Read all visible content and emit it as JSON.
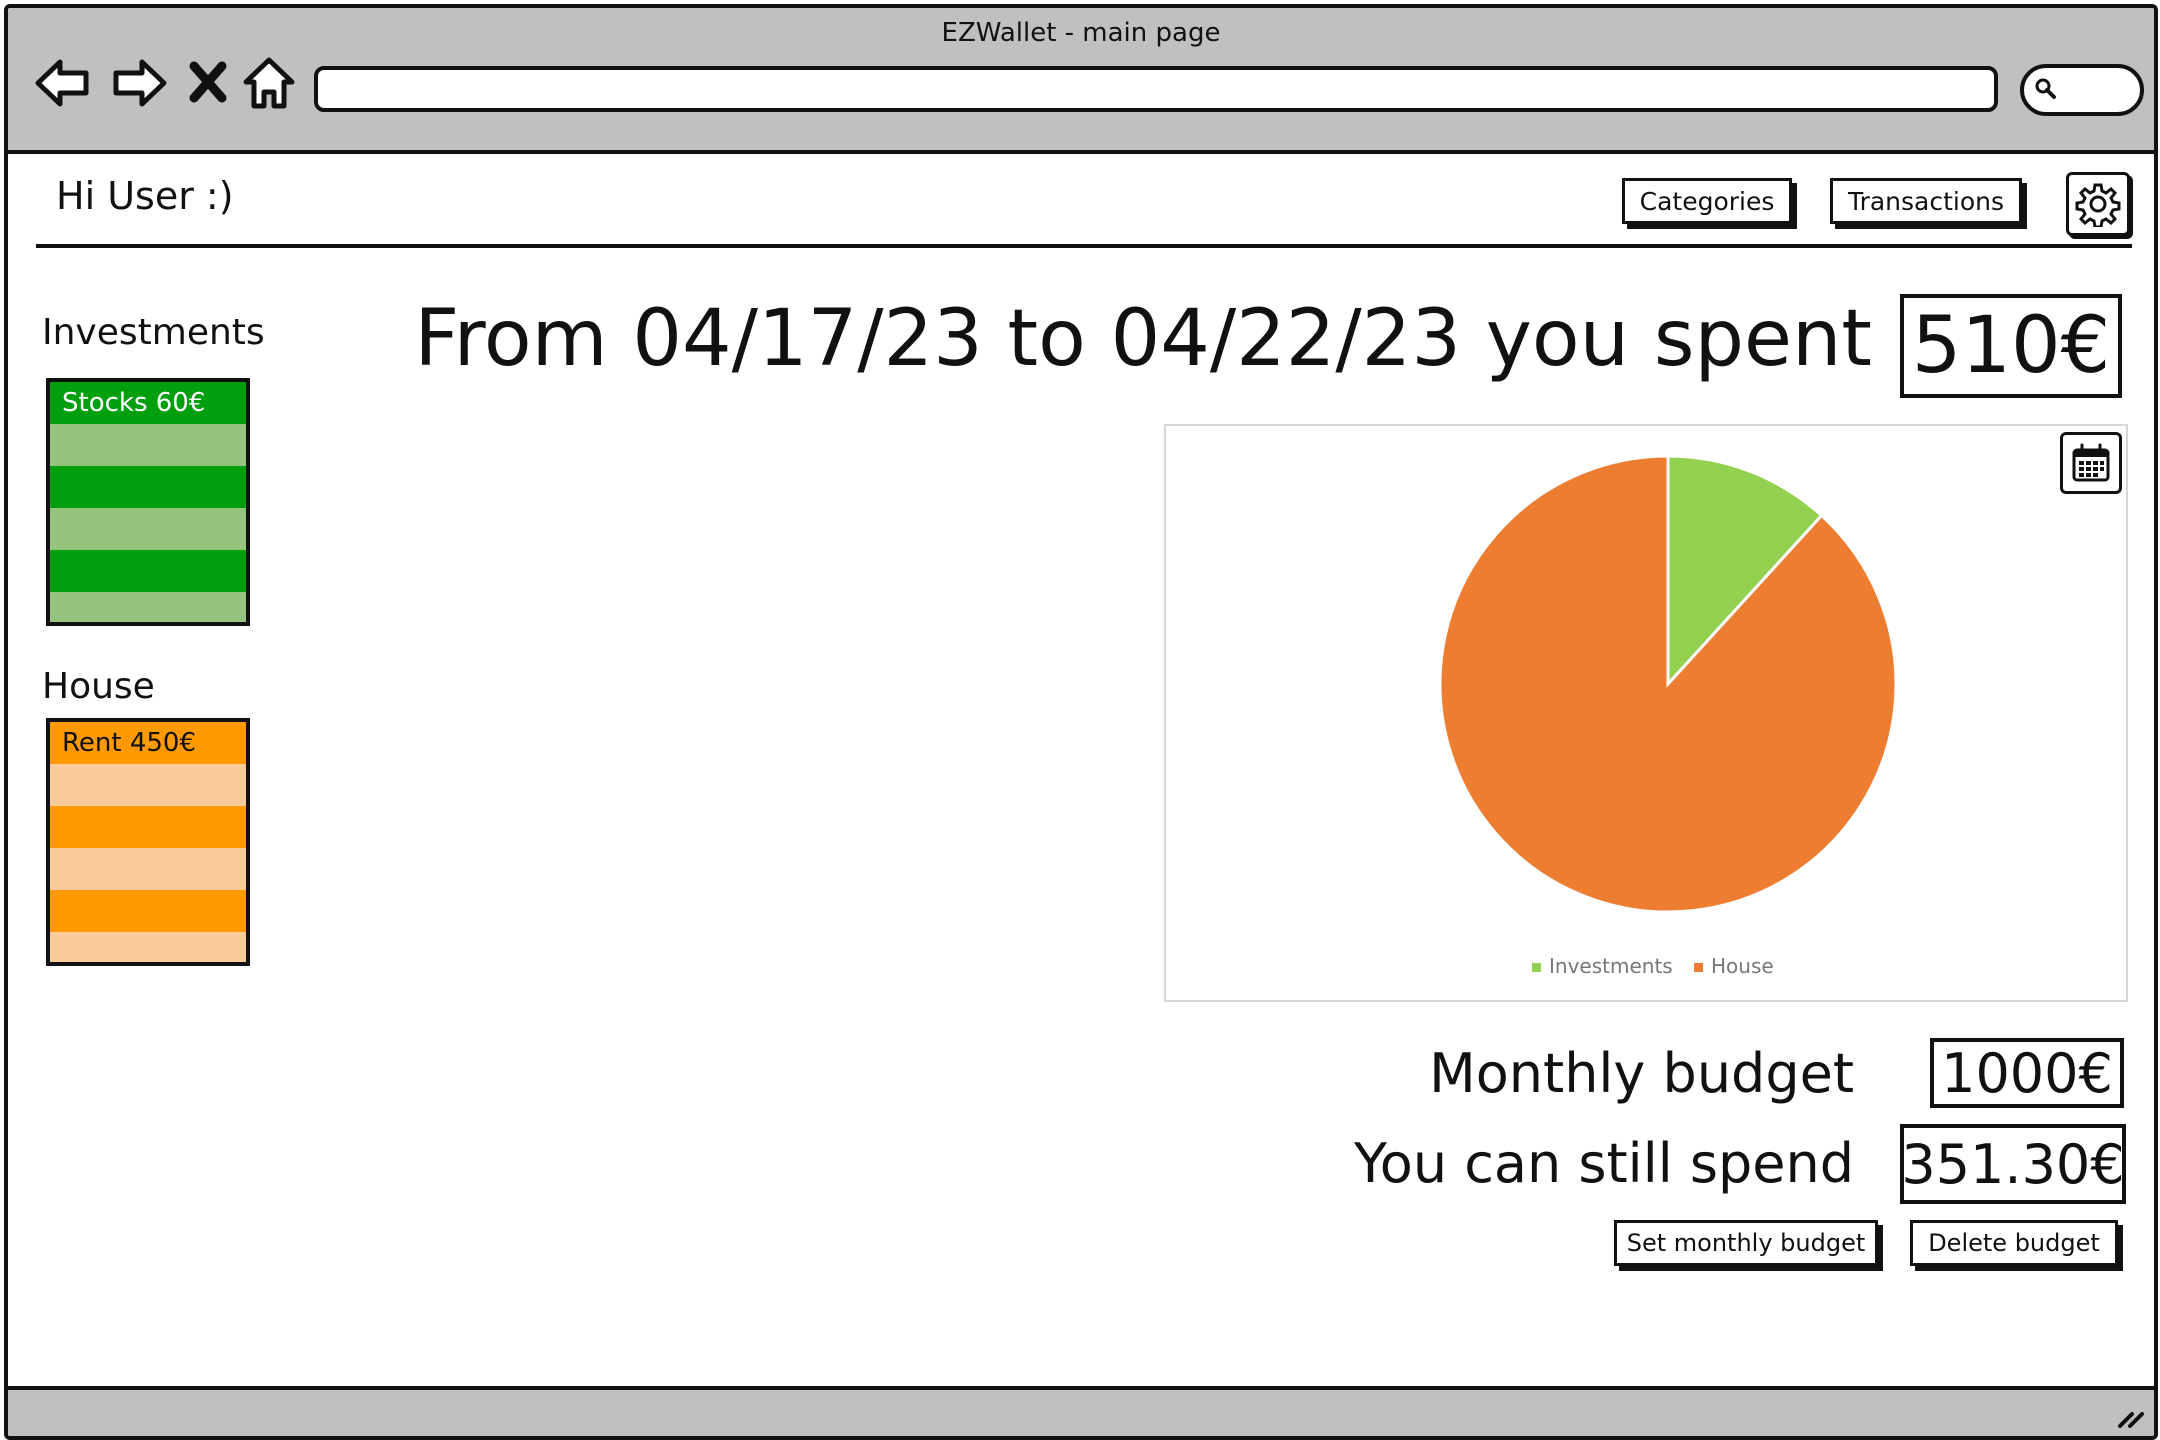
{
  "window": {
    "title": "EZWallet - main page"
  },
  "browser": {
    "icons": [
      "back-arrow-icon",
      "forward-arrow-icon",
      "close-x-icon",
      "home-icon",
      "search-icon"
    ],
    "address_value": ""
  },
  "header": {
    "greeting": "Hi User :)",
    "categories_label": "Categories",
    "transactions_label": "Transactions",
    "settings_icon": "gear-icon"
  },
  "categories": [
    {
      "name": "Investments",
      "color": "#009f0d",
      "stripe_colors": [
        "#009f0d",
        "#95c47f"
      ],
      "items": [
        {
          "label": "Stocks 60€",
          "text_color": "#ffffff"
        }
      ]
    },
    {
      "name": "House",
      "color": "#ff9900",
      "stripe_colors": [
        "#ff9900",
        "#f9ca9a"
      ],
      "items": [
        {
          "label": "Rent 450€",
          "text_color": "#111111"
        }
      ]
    }
  ],
  "summary": {
    "period_text": "From 04/17/23 to 04/22/23 you spent",
    "total": "510€"
  },
  "chart": {
    "calendar_icon": "calendar-icon"
  },
  "chart_data": {
    "type": "pie",
    "series": [
      {
        "name": "Investments",
        "value": 60,
        "color": "#92d050"
      },
      {
        "name": "House",
        "value": 450,
        "color": "#ed7d31"
      }
    ],
    "legend_position": "bottom"
  },
  "budget": {
    "monthly_label": "Monthly budget",
    "monthly_value": "1000€",
    "remaining_label": "You can still spend",
    "remaining_value": "351.30€",
    "set_button": "Set monthly budget",
    "delete_button": "Delete budget"
  }
}
